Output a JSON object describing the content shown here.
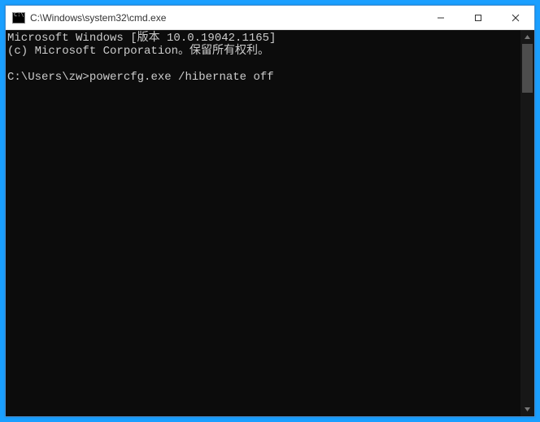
{
  "window": {
    "title": "C:\\Windows\\system32\\cmd.exe"
  },
  "console": {
    "line1": "Microsoft Windows [版本 10.0.19042.1165]",
    "line2": "(c) Microsoft Corporation。保留所有权利。",
    "blank": "",
    "prompt": "C:\\Users\\zw>",
    "command": "powercfg.exe /hibernate off"
  }
}
